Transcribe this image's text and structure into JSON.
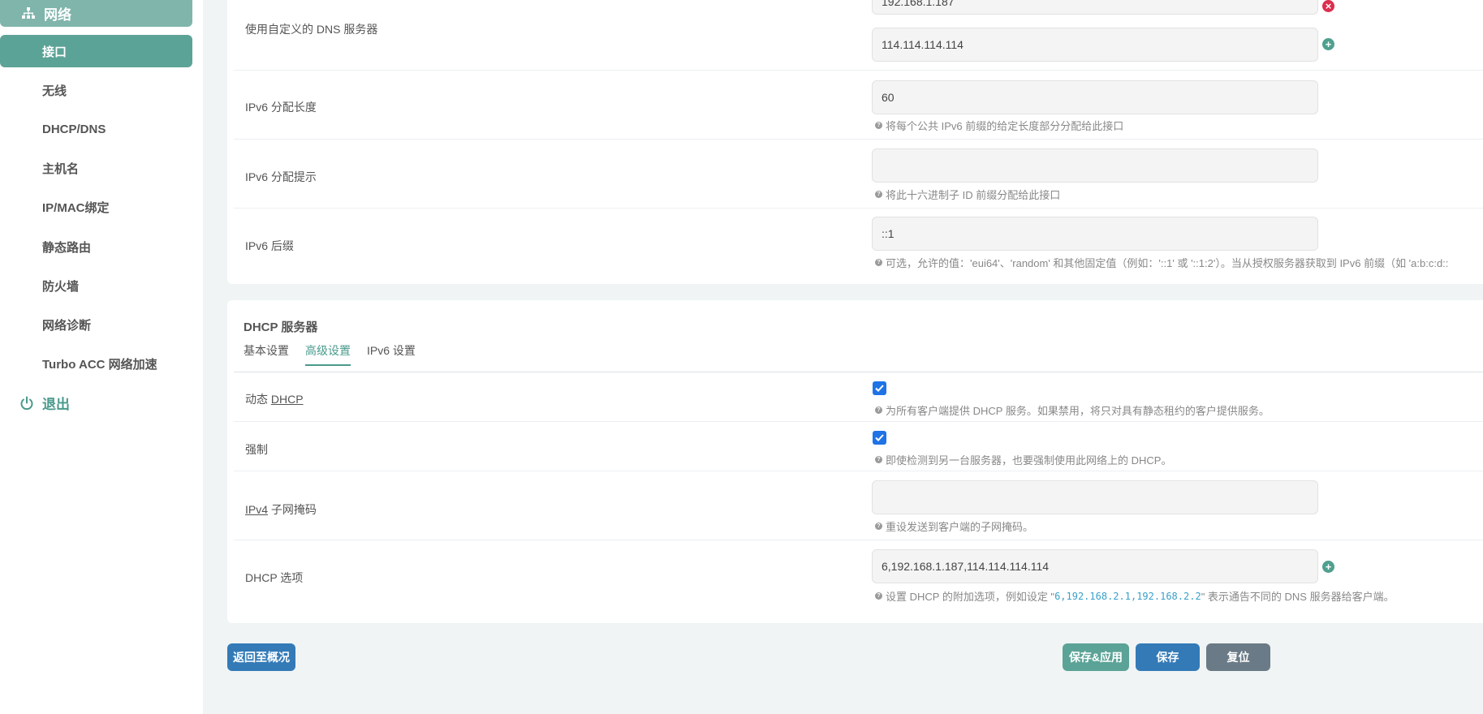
{
  "sidebar": {
    "group_label": "网络",
    "items": [
      {
        "label": "接口",
        "active": true
      },
      {
        "label": "无线"
      },
      {
        "label": "DHCP/DNS"
      },
      {
        "label": "主机名"
      },
      {
        "label": "IP/MAC绑定"
      },
      {
        "label": "静态路由"
      },
      {
        "label": "防火墙"
      },
      {
        "label": "网络诊断"
      },
      {
        "label": "Turbo ACC 网络加速"
      }
    ],
    "logout_label": "退出"
  },
  "ipv6_settings": {
    "dns": {
      "label": "使用自定义的 DNS 服务器",
      "values": [
        "192.168.1.187",
        "114.114.114.114"
      ]
    },
    "assign_length": {
      "label": "IPv6 分配长度",
      "value": "60",
      "hint": "将每个公共 IPv6 前缀的给定长度部分分配给此接口"
    },
    "assign_hint": {
      "label": "IPv6 分配提示",
      "value": "",
      "hint": "将此十六进制子 ID 前缀分配给此接口"
    },
    "suffix": {
      "label": "IPv6 后缀",
      "value": "::1",
      "hint": "可选，允许的值：'eui64'、'random' 和其他固定值（例如：'::1' 或 '::1:2'）。当从授权服务器获取到 IPv6 前缀（如 'a:b:c:d::"
    }
  },
  "dhcp_server": {
    "title": "DHCP 服务器",
    "tabs": [
      {
        "label": "基本设置"
      },
      {
        "label": "高级设置",
        "active": true
      },
      {
        "label": "IPv6 设置"
      }
    ],
    "dynamic": {
      "label_prefix": "动态 ",
      "label_link": "DHCP",
      "checked": true,
      "hint": "为所有客户端提供 DHCP 服务。如果禁用，将只对具有静态租约的客户提供服务。"
    },
    "force": {
      "label": "强制",
      "checked": true,
      "hint": "即使检测到另一台服务器，也要强制使用此网络上的 DHCP。"
    },
    "netmask": {
      "label_link": "IPv4",
      "label_suffix": " 子网掩码",
      "value": "",
      "hint": "重设发送到客户端的子网掩码。"
    },
    "options": {
      "label": "DHCP 选项",
      "value": "6,192.168.1.187,114.114.114.114",
      "hint_before": "设置 DHCP 的附加选项，例如设定 \"",
      "hint_code": "6,192.168.2.1,192.168.2.2",
      "hint_after": "\" 表示通告不同的 DNS 服务器给客户端。"
    }
  },
  "actions": {
    "back": "返回至概况",
    "save_apply": "保存&应用",
    "save": "保存",
    "reset": "复位"
  },
  "colors": {
    "accent": "#5ba396",
    "primary": "#337ab7",
    "danger": "#dc2e4e",
    "checkbox": "#1f73e6"
  }
}
